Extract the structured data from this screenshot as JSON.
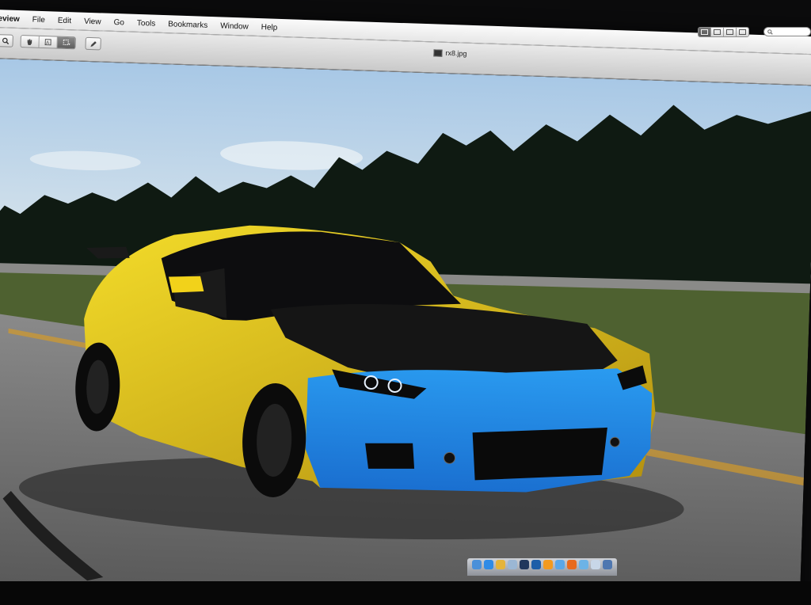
{
  "menubar": {
    "app_name": "review",
    "items": [
      "File",
      "Edit",
      "View",
      "Go",
      "Tools",
      "Bookmarks",
      "Window",
      "Help"
    ]
  },
  "toolbar": {
    "zoom_icon": "magnifier-icon",
    "move_icon": "hand-icon",
    "text_icon": "text-select-icon",
    "select_icon": "rect-select-icon",
    "annotate_icon": "pencil-icon"
  },
  "document": {
    "title": "rx8.jpg"
  },
  "view_buttons": [
    "single-page-icon",
    "two-page-icon",
    "grid-icon",
    "sidebar-icon"
  ],
  "search": {
    "placeholder": "Q"
  },
  "image": {
    "subject": "yellow and blue car on road",
    "colors": {
      "sky": "#9fc3e3",
      "trees": "#101a12",
      "grass": "#4d5f2e",
      "road": "#6f6f6f",
      "car_yellow": "#f2d21a",
      "car_blue": "#1e88e0",
      "hood_black": "#151515"
    }
  },
  "dock": {
    "icons": [
      "finder-icon",
      "safari-icon",
      "chrome-icon",
      "mail-icon",
      "ps-icon",
      "ps-icon-2",
      "ai-icon",
      "itunes-icon",
      "firefox-icon",
      "preview-icon",
      "app-icon",
      "app-icon-2"
    ],
    "colors": [
      "#4a90d9",
      "#2f8be6",
      "#e4b43a",
      "#9bb7d4",
      "#20375c",
      "#1d5ea8",
      "#f39a1e",
      "#5aa7e8",
      "#e86a1e",
      "#6cb3e6",
      "#c8d7e8",
      "#4f77b0"
    ]
  }
}
